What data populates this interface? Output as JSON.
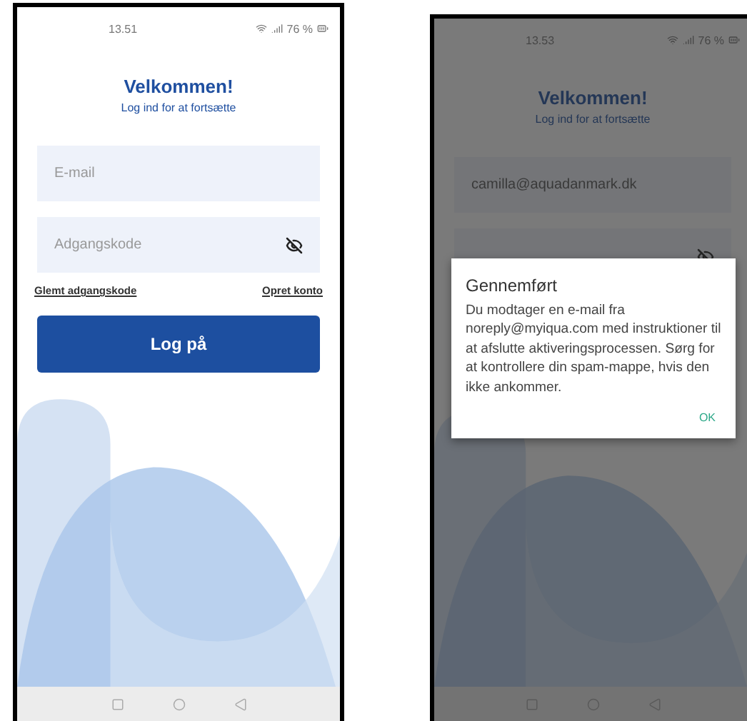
{
  "screens": [
    {
      "status_bar": {
        "time": "13.51",
        "battery": "76 %"
      },
      "title": "Velkommen!",
      "subtitle": "Log ind for at fortsætte",
      "email_field": {
        "placeholder": "E-mail"
      },
      "password_field": {
        "placeholder": "Adgangskode"
      },
      "links": [
        "Glemt adgangskode",
        "Opret konto"
      ],
      "login_button": {
        "label": "Log på"
      }
    },
    {
      "status_bar": {
        "time": "13.53",
        "battery": "76 %"
      },
      "title": "Velkommen!",
      "subtitle": "Log ind for at fortsætte",
      "email_field": {
        "value": "camilla@aquadanmark.dk"
      },
      "dialog": {
        "title": "Gennemført",
        "message": "Du modtager en e-mail fra noreply@myiqua.com med instruktioner til at afslutte aktiveringsprocessen. Sørg for at kontrollere din spam-mappe, hvis den ikke ankommer.",
        "button": "OK"
      }
    }
  ]
}
